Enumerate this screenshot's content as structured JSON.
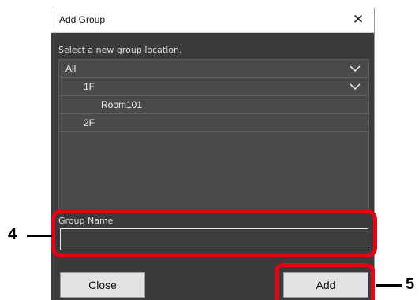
{
  "dialog": {
    "title": "Add Group",
    "close_glyph": "✕",
    "prompt": "Select a new group location.",
    "tree": [
      {
        "label": "All",
        "expanded": true,
        "level": 0
      },
      {
        "label": "1F",
        "expanded": true,
        "level": 1
      },
      {
        "label": "Room101",
        "expanded": false,
        "level": 2
      },
      {
        "label": "2F",
        "expanded": false,
        "level": 1
      }
    ],
    "group_name_label": "Group Name",
    "group_name_value": "",
    "close_button": "Close",
    "add_button": "Add"
  },
  "callouts": {
    "group_name_marker": "4",
    "add_marker": "5"
  },
  "colors": {
    "dialog_bg": "#3b3b3b",
    "tree_bg": "#4a4a4a",
    "highlight": "#e60012"
  }
}
